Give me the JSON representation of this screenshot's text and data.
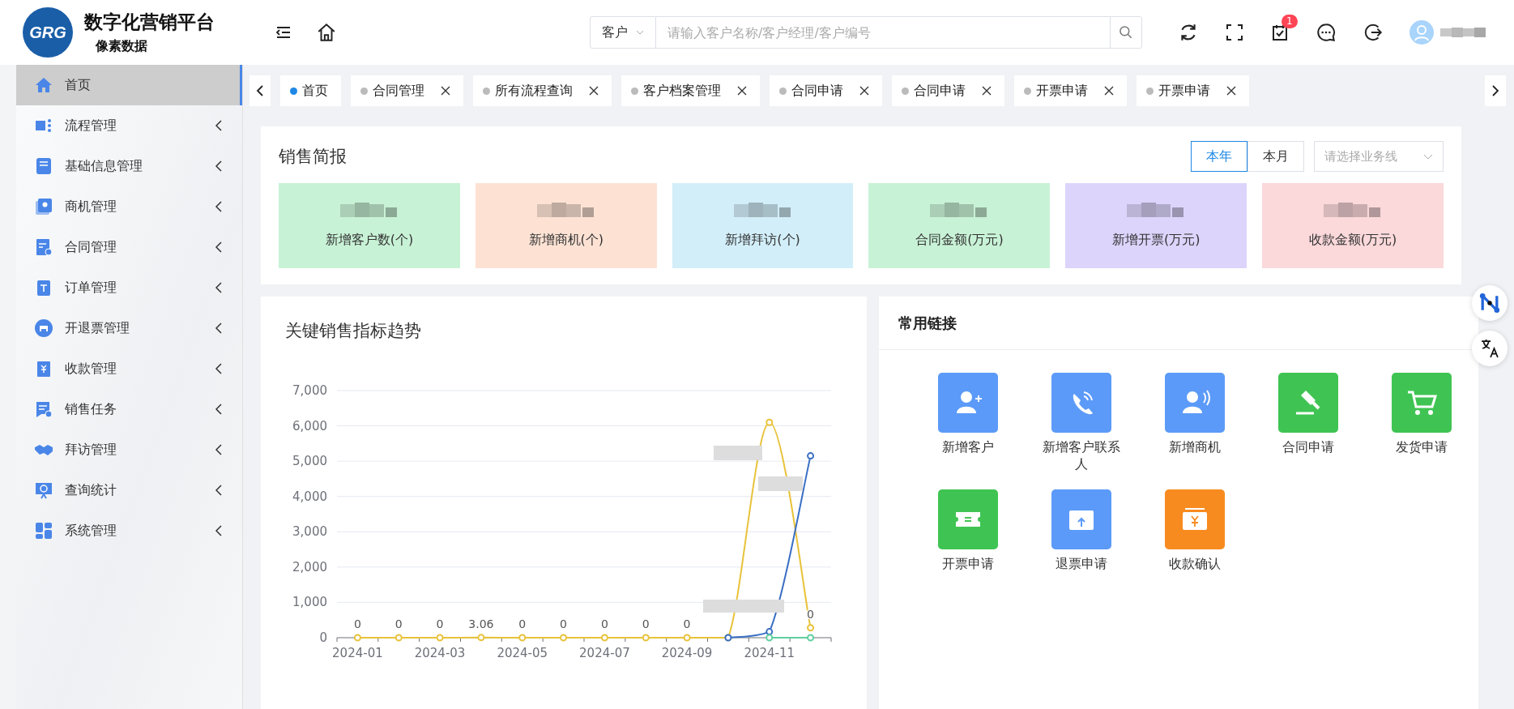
{
  "header": {
    "logo": "GRG",
    "title": "数字化营销平台",
    "subtitle": "像素数据",
    "search": {
      "scope": "客户",
      "placeholder": "请输入客户名称/客户经理/客户编号"
    },
    "todo_badge": "1"
  },
  "sidebar": {
    "items": [
      {
        "label": "首页",
        "selected": true
      },
      {
        "label": "流程管理",
        "selected": false
      },
      {
        "label": "基础信息管理",
        "selected": false
      },
      {
        "label": "商机管理",
        "selected": false
      },
      {
        "label": "合同管理",
        "selected": false
      },
      {
        "label": "订单管理",
        "selected": false
      },
      {
        "label": "开退票管理",
        "selected": false
      },
      {
        "label": "收款管理",
        "selected": false
      },
      {
        "label": "销售任务",
        "selected": false
      },
      {
        "label": "拜访管理",
        "selected": false
      },
      {
        "label": "查询统计",
        "selected": false
      },
      {
        "label": "系统管理",
        "selected": false
      }
    ]
  },
  "tabs": [
    {
      "label": "首页",
      "selected": true,
      "closable": false
    },
    {
      "label": "合同管理",
      "selected": false,
      "closable": true
    },
    {
      "label": "所有流程查询",
      "selected": false,
      "closable": true
    },
    {
      "label": "客户档案管理",
      "selected": false,
      "closable": true
    },
    {
      "label": "合同申请",
      "selected": false,
      "closable": true
    },
    {
      "label": "合同申请",
      "selected": false,
      "closable": true
    },
    {
      "label": "开票申请",
      "selected": false,
      "closable": true
    },
    {
      "label": "开票申请",
      "selected": false,
      "closable": true
    }
  ],
  "sales_summary": {
    "title": "销售简报",
    "periods": [
      {
        "label": "本年",
        "selected": true
      },
      {
        "label": "本月",
        "selected": false
      }
    ],
    "business_line": {
      "placeholder": "请选择业务线"
    },
    "cards": [
      {
        "label": "新增客户数(个)",
        "color": "#c8f2d6"
      },
      {
        "label": "新增商机(个)",
        "color": "#fde2d4"
      },
      {
        "label": "新增拜访(个)",
        "color": "#d2eef9"
      },
      {
        "label": "合同金额(万元)",
        "color": "#c8f2d6"
      },
      {
        "label": "新增开票(万元)",
        "color": "#dcd4fb"
      },
      {
        "label": "收款金额(万元)",
        "color": "#fbd8da"
      }
    ]
  },
  "trend": {
    "title": "关键销售指标趋势",
    "chart_data": {
      "type": "line",
      "grid": true,
      "categories": [
        "2024-01",
        null,
        "2024-03",
        null,
        "2024-05",
        null,
        "2024-07",
        null,
        "2024-09",
        null,
        "2024-11",
        null
      ],
      "ylim": [
        0,
        7000
      ],
      "yticks": [
        {
          "value": 0,
          "label": "0"
        },
        {
          "value": 1000,
          "label": "1,000"
        },
        {
          "value": 2000,
          "label": "2,000"
        },
        {
          "value": 3000,
          "label": "3,000"
        },
        {
          "value": 4000,
          "label": "4,000"
        },
        {
          "value": 5000,
          "label": "5,000"
        },
        {
          "value": 6000,
          "label": "6,000"
        },
        {
          "value": 7000,
          "label": "7,000"
        }
      ],
      "series": [
        {
          "color": "#e8c23a",
          "marker": "circle",
          "values": [
            0,
            0,
            0,
            3.06,
            0,
            0,
            0,
            0,
            0,
            0,
            6100,
            280
          ]
        },
        {
          "color": "#3a6fc4",
          "marker": "circle",
          "values": [
            null,
            null,
            null,
            null,
            null,
            null,
            null,
            null,
            null,
            0,
            170,
            5150
          ]
        },
        {
          "color": "#5fd0a0",
          "marker": "circle",
          "values": [
            null,
            null,
            null,
            null,
            null,
            null,
            null,
            null,
            null,
            null,
            0,
            0
          ]
        }
      ],
      "value_labels": [
        "0",
        "0",
        "0",
        "3.06",
        "0",
        "0",
        "0",
        "0",
        "0",
        null,
        null,
        "0"
      ]
    }
  },
  "links": {
    "title": "常用链接",
    "items": [
      {
        "label": "新增客户",
        "color": "#5b9af8"
      },
      {
        "label": "新增客户联系人",
        "color": "#5b9af8"
      },
      {
        "label": "新增商机",
        "color": "#5b9af8"
      },
      {
        "label": "合同申请",
        "color": "#3fc453"
      },
      {
        "label": "发货申请",
        "color": "#3fc453"
      },
      {
        "label": "开票申请",
        "color": "#3fc453"
      },
      {
        "label": "退票申请",
        "color": "#5b9af8"
      },
      {
        "label": "收款确认",
        "color": "#f88b1f"
      }
    ]
  }
}
